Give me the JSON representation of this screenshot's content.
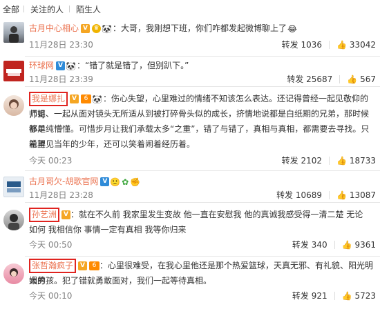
{
  "filter": {
    "items": [
      "全部",
      "关注的人",
      "陌生人"
    ]
  },
  "comments": [
    {
      "name": "古月中心相心",
      "body": "：大哥，我刚想下班，你们咋都发起微博聊上了",
      "time": "11月28日 23:30",
      "repost_label": "转发",
      "repost_count": "1036",
      "like_count": "33042"
    },
    {
      "name": "环球网",
      "body": "：“错了就是错了，但别趴下。”",
      "time": "11月28日 23:39",
      "repost_label": "转发",
      "repost_count": "25687",
      "like_count": "567"
    },
    {
      "name": "我是娜扎",
      "body_lines": [
        "：伤心失望，心里难过的情绪不知该怎么表达。还记得曾经一起见敬仰的师哥",
        "师姐、一起从面对镜头无所适从到被打碎骨头似的成长，挤情地说都是白纸期的兄弟，那时候都足",
        "够单纯懵懂。可惜步月让我们承载太多“之重”，错了与错了，真相与真相，都需要去寻找。只希望",
        "能再见当年的少年，还可以笑着闹着经历着。"
      ],
      "time": "今天 00:23",
      "repost_label": "转发",
      "repost_count": "2102",
      "like_count": "18733"
    },
    {
      "name": "古月哥欠-胡歌官网",
      "body": "",
      "time": "11月28日 23:28",
      "repost_label": "转发",
      "repost_count": "10689",
      "like_count": "13087"
    },
    {
      "name": "孙艺洲",
      "body_lines": [
        "：就在不久前 我家里发生变故 他一直在安慰我 他的真诚我感受得一清二楚 无论",
        "如何 我相信你 事情一定有真相 我等你归来"
      ],
      "time": "今天 00:50",
      "repost_label": "转发",
      "repost_count": "340",
      "like_count": "9361"
    },
    {
      "name": "张哲瀚疯子",
      "body_lines": [
        "：心里很难受，在我心里他还是那个热爱篮球，天真无邪、有礼貌、阳光明媚的",
        "大男孩。犯了错就勇敢面对，我们一起等待真相。"
      ],
      "time": "今天 00:10",
      "repost_label": "转发",
      "repost_count": "921",
      "like_count": "5723"
    }
  ]
}
